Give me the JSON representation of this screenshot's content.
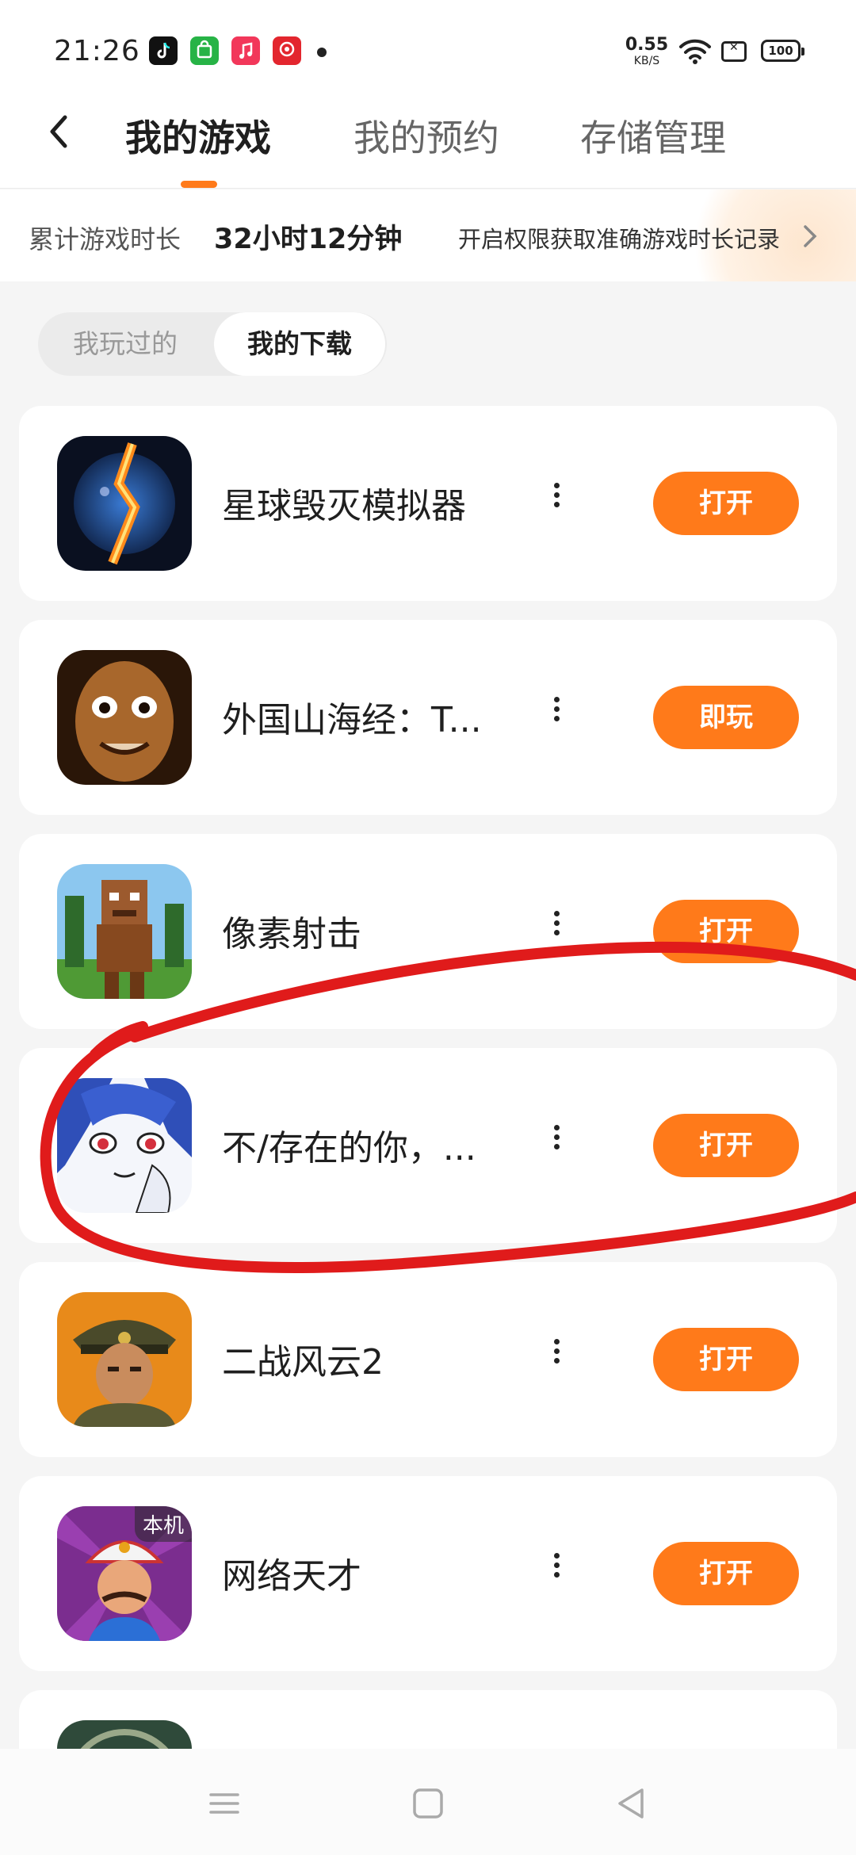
{
  "status_bar": {
    "time": "21:26",
    "net_speed_value": "0.55",
    "net_speed_unit": "KB/S",
    "battery": "100"
  },
  "header": {
    "tabs": [
      {
        "label": "我的游戏",
        "active": true
      },
      {
        "label": "我的预约",
        "active": false
      },
      {
        "label": "存储管理",
        "active": false
      }
    ]
  },
  "stats": {
    "label": "累计游戏时长",
    "value": "32小时12分钟",
    "link": "开启权限获取准确游戏时长记录"
  },
  "segment": {
    "items": [
      {
        "label": "我玩过的",
        "selected": false
      },
      {
        "label": "我的下载",
        "selected": true
      }
    ]
  },
  "games": [
    {
      "name": "星球毁灭模拟器",
      "button": "打开",
      "icon": "planet-icon"
    },
    {
      "name": "外国山海经：T...",
      "button": "即玩",
      "icon": "face-icon"
    },
    {
      "name": "像素射击",
      "button": "打开",
      "icon": "pixel-character-icon"
    },
    {
      "name": "不/存在的你，...",
      "button": "打开",
      "icon": "anime-girl-icon"
    },
    {
      "name": "二战风云2",
      "button": "打开",
      "icon": "soldier-icon"
    },
    {
      "name": "网络天才",
      "button": "打开",
      "icon": "genie-icon",
      "badge": "本机"
    }
  ],
  "colors": {
    "accent": "#ff7a1a",
    "annotation": "#e01b1b",
    "background": "#f5f5f5"
  }
}
